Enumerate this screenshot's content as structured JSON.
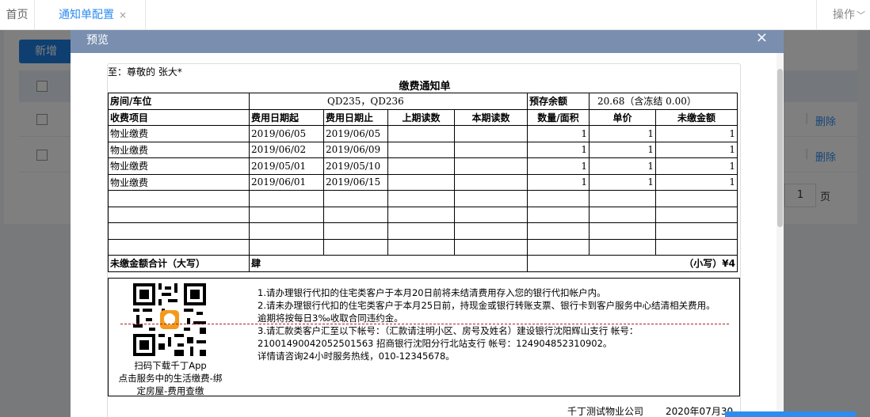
{
  "tabs": {
    "home": "首页",
    "active": "通知单配置",
    "close": "×",
    "ops": "操作",
    "ops_chev": "﹀"
  },
  "bg": {
    "new_button": "新增",
    "delete": "删除",
    "page_num": "1",
    "page_unit": "页"
  },
  "modal": {
    "title": "预览",
    "close": "×"
  },
  "notice": {
    "to": "至：尊敬的 张大*",
    "title": "缴费通知单",
    "room_label": "房间/车位",
    "room_value": "QD235，QD236",
    "balance_label": "预存余额",
    "balance_value": "20.68（含冻结 0.00）",
    "columns": [
      "收费项目",
      "费用日期起",
      "费用日期止",
      "上期读数",
      "本期读数",
      "数量/面积",
      "单价",
      "未缴金额"
    ],
    "rows": [
      [
        "物业缴费",
        "2019/06/05",
        "2019/06/05",
        "",
        "",
        "1",
        "1",
        "1"
      ],
      [
        "物业缴费",
        "2019/06/02",
        "2019/06/09",
        "",
        "",
        "1",
        "1",
        "1"
      ],
      [
        "物业缴费",
        "2019/05/01",
        "2019/05/10",
        "",
        "",
        "1",
        "1",
        "1"
      ],
      [
        "物业缴费",
        "2019/06/01",
        "2019/06/15",
        "",
        "",
        "1",
        "1",
        "1"
      ]
    ],
    "empty_rows": 4,
    "total_label": "未缴金额合计（大写）",
    "total_upper": "肆",
    "total_lower": "（小写）¥4",
    "qr_caption": [
      "扫码下载千丁App",
      "点击服务中的生活缴费-绑",
      "定房屋-费用查缴"
    ],
    "notes": [
      "1.请办理银行代扣的住宅类客户于本月20日前将未结清费用存入您的银行代扣帐户内。",
      "2.请未办理银行代扣的住宅类客户于本月25日前，持现金或银行转账支票、银行卡到客户服务中心结清相关费用。",
      "逾期将按每日3‰收取合同违约金。",
      "3.请汇款类客户汇至以下帐号：（汇款请注明小区、房号及姓名）建设银行沈阳辉山支行 帐号：",
      "21001490042052501563 招商银行沈阳分行北站支行 帐号：124904852310902。",
      "详情请咨询24小时服务热线，010-12345678。"
    ],
    "company": "千丁测试物业公司",
    "date": "2020年07月30日"
  },
  "colors": {
    "accent": "#2d8cf0",
    "modal_header": "#7a8fb0",
    "redline": "#b02020"
  }
}
